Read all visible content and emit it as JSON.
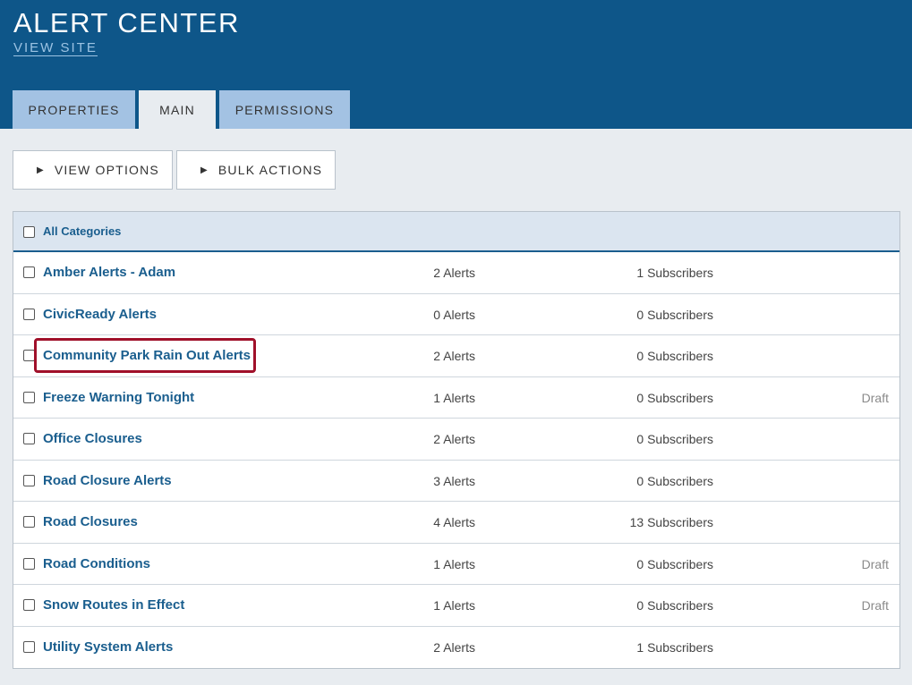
{
  "header": {
    "title": "ALERT CENTER",
    "view_site": "VIEW SITE"
  },
  "tabs": [
    {
      "label": "PROPERTIES",
      "active": false
    },
    {
      "label": "MAIN",
      "active": true
    },
    {
      "label": "PERMISSIONS",
      "active": false
    }
  ],
  "toolbar": {
    "view_options": "VIEW OPTIONS",
    "bulk_actions": "BULK ACTIONS",
    "triangle_icon": "▶"
  },
  "table": {
    "header_label": "All Categories",
    "rows": [
      {
        "name": "Amber Alerts - Adam",
        "alerts": "2  Alerts",
        "subscribers": "1  Subscribers",
        "status": ""
      },
      {
        "name": "CivicReady Alerts",
        "alerts": "0  Alerts",
        "subscribers": "0  Subscribers",
        "status": ""
      },
      {
        "name": "Community Park Rain Out Alerts",
        "alerts": "2  Alerts",
        "subscribers": "0  Subscribers",
        "status": ""
      },
      {
        "name": "Freeze Warning Tonight",
        "alerts": "1  Alerts",
        "subscribers": "0  Subscribers",
        "status": "Draft"
      },
      {
        "name": "Office Closures",
        "alerts": "2  Alerts",
        "subscribers": "0  Subscribers",
        "status": ""
      },
      {
        "name": "Road Closure Alerts",
        "alerts": "3  Alerts",
        "subscribers": "0  Subscribers",
        "status": ""
      },
      {
        "name": "Road Closures",
        "alerts": "4  Alerts",
        "subscribers": "13  Subscribers",
        "status": ""
      },
      {
        "name": "Road Conditions",
        "alerts": "1  Alerts",
        "subscribers": "0  Subscribers",
        "status": "Draft"
      },
      {
        "name": "Snow Routes in Effect",
        "alerts": "1  Alerts",
        "subscribers": "0  Subscribers",
        "status": "Draft"
      },
      {
        "name": "Utility System Alerts",
        "alerts": "2  Alerts",
        "subscribers": "1  Subscribers",
        "status": ""
      }
    ]
  },
  "colors": {
    "header_bg": "#0e5689",
    "tab_bg": "#a3c2e3",
    "link": "#1a5e8e",
    "highlight": "#a0102a"
  }
}
